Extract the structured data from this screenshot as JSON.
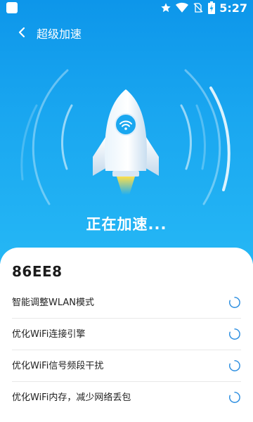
{
  "status_bar": {
    "time": "5:27"
  },
  "app_bar": {
    "title": "超级加速"
  },
  "hero": {
    "status_text": "正在加速..."
  },
  "network": {
    "ssid": "86EE8"
  },
  "tasks": [
    {
      "label": "智能调整WLAN模式"
    },
    {
      "label": "优化WiFi连接引擎"
    },
    {
      "label": "优化WiFi信号频段干扰"
    },
    {
      "label": "优化WiFi内存，减少网络丢包"
    }
  ],
  "colors": {
    "hero_gradient_top": "#0d96ea",
    "hero_gradient_bottom": "#25b7f5",
    "spinner": "#2a8de0",
    "flame": "#ffe04a"
  },
  "icons": [
    "back-arrow-icon",
    "star-icon",
    "wifi-icon",
    "no-sim-icon",
    "battery-icon",
    "rocket-icon",
    "loading-spinner-icon"
  ]
}
